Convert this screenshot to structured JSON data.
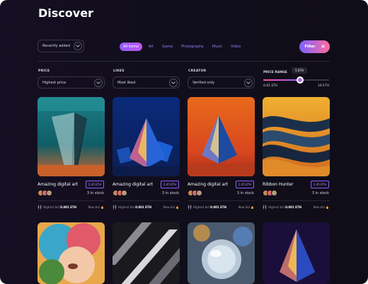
{
  "page": {
    "title": "Discover"
  },
  "sort": {
    "label": "Recently added"
  },
  "tabs": [
    {
      "label": "All items",
      "active": true
    },
    {
      "label": "Art"
    },
    {
      "label": "Game"
    },
    {
      "label": "Photography"
    },
    {
      "label": "Music"
    },
    {
      "label": "Video"
    }
  ],
  "filter_button": {
    "label": "Filter",
    "icon": "close-icon"
  },
  "filters": {
    "price": {
      "label": "PRICE",
      "value": "Highest price"
    },
    "likes": {
      "label": "LIKES",
      "value": "Most liked"
    },
    "creator": {
      "label": "CREATOR",
      "value": "Verified only"
    },
    "price_range": {
      "label": "PRICE RANGE",
      "tooltip": "5 ETH",
      "min": "0.01 ETH",
      "max": "10 ETH",
      "fill_fraction": 0.56
    }
  },
  "cards": [
    {
      "name": "Amazing digital art",
      "price": "2.45 ETH",
      "stock": "3 in stock",
      "bid_label": "Highest bid",
      "bid_value": "0.001 ETH",
      "new_bid": "New bid 🔥"
    },
    {
      "name": "Amazing digital art",
      "price": "2.45 ETH",
      "stock": "3 in stock",
      "bid_label": "Highest bid",
      "bid_value": "0.001 ETH",
      "new_bid": "New bid 🔥"
    },
    {
      "name": "Amazing digital art",
      "price": "2.45 ETH",
      "stock": "3 in stock",
      "bid_label": "Highest bid",
      "bid_value": "0.001 ETH",
      "new_bid": "New bid 🔥"
    },
    {
      "name": "Ribbon Hunter",
      "price": "2.45 ETH",
      "stock": "3 in stock",
      "bid_label": "Highest bid",
      "bid_value": "0.001 ETH",
      "new_bid": "New bid 🔥"
    }
  ],
  "colors": {
    "accent": "#9b5cff",
    "background": "#0f0d18",
    "filter_gradient_start": "#7b63ff",
    "filter_gradient_end": "#ff6a9e"
  }
}
